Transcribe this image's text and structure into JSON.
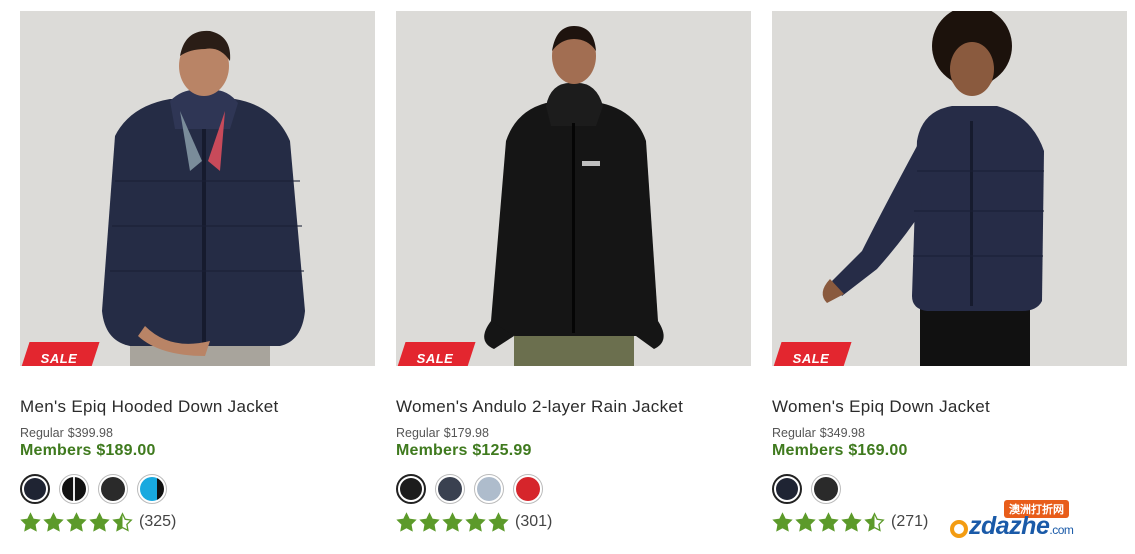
{
  "products": [
    {
      "image_alt": "Man wearing navy hooded down jacket",
      "badge": "SALE",
      "name": "Men's Epiq Hooded Down Jacket",
      "regular_label": "Regular",
      "regular_price": "$399.98",
      "members_label": "Members",
      "members_price": "$189.00",
      "swatches": [
        "#1f2433",
        "#111111",
        "#2a2a2a",
        "#18a9df"
      ],
      "rating": 4.5,
      "review_count": "(325)"
    },
    {
      "image_alt": "Woman wearing black rain jacket",
      "badge": "SALE",
      "name": "Women's Andulo 2-layer Rain Jacket",
      "regular_label": "Regular",
      "regular_price": "$179.98",
      "members_label": "Members",
      "members_price": "$125.99",
      "swatches": [
        "#1c1c1c",
        "#3a4150",
        "#aebccc",
        "#d6252b"
      ],
      "rating": 5,
      "review_count": "(301)"
    },
    {
      "image_alt": "Woman wearing navy down jacket",
      "badge": "SALE",
      "name": "Women's Epiq Down Jacket",
      "regular_label": "Regular",
      "regular_price": "$349.98",
      "members_label": "Members",
      "members_price": "$169.00",
      "swatches": [
        "#1f2433",
        "#2a2a2a"
      ],
      "rating": 4.5,
      "review_count": "(271)"
    }
  ],
  "watermark": {
    "tag": "澳洲打折网",
    "word": "zdazhe",
    "suffix": ".com"
  },
  "colors": {
    "sale_red": "#e3262f",
    "member_green": "#3f7a1e",
    "star_green": "#5c9a2a"
  }
}
